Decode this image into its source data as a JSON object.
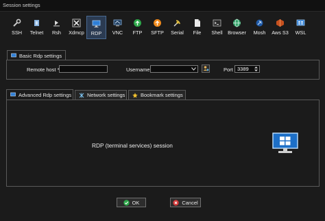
{
  "window": {
    "title": "Session settings"
  },
  "session_types": [
    {
      "label": "SSH",
      "icon": "wrench-icon"
    },
    {
      "label": "Telnet",
      "icon": "telnet-icon"
    },
    {
      "label": "Rsh",
      "icon": "rsh-icon"
    },
    {
      "label": "Xdmcp",
      "icon": "x-icon"
    },
    {
      "label": "RDP",
      "icon": "rdp-icon",
      "selected": true
    },
    {
      "label": "VNC",
      "icon": "vnc-icon"
    },
    {
      "label": "FTP",
      "icon": "ftp-icon"
    },
    {
      "label": "SFTP",
      "icon": "sftp-icon"
    },
    {
      "label": "Serial",
      "icon": "satellite-icon"
    },
    {
      "label": "File",
      "icon": "file-icon"
    },
    {
      "label": "Shell",
      "icon": "terminal-icon"
    },
    {
      "label": "Browser",
      "icon": "globe-icon"
    },
    {
      "label": "Mosh",
      "icon": "antenna-icon"
    },
    {
      "label": "Aws S3",
      "icon": "aws-icon"
    },
    {
      "label": "WSL",
      "icon": "wsl-icon"
    }
  ],
  "basic": {
    "tab_label": "Basic Rdp settings",
    "remote_host_label": "Remote host *",
    "remote_host_value": "",
    "username_label": "Username",
    "username_value": "",
    "port_label": "Port",
    "port_value": "3389"
  },
  "advanced_tabs": [
    {
      "label": "Advanced Rdp settings",
      "icon": "monitor-icon"
    },
    {
      "label": "Network settings",
      "icon": "network-icon"
    },
    {
      "label": "Bookmark settings",
      "icon": "star-icon"
    }
  ],
  "content": {
    "description": "RDP (terminal services) session"
  },
  "buttons": {
    "ok_label": "OK",
    "cancel_label": "Cancel"
  },
  "colors": {
    "accent": "#2f7fd6",
    "ok_green": "#2ea84a",
    "cancel_red": "#d23a3a",
    "star_yellow": "#f2c12e"
  }
}
